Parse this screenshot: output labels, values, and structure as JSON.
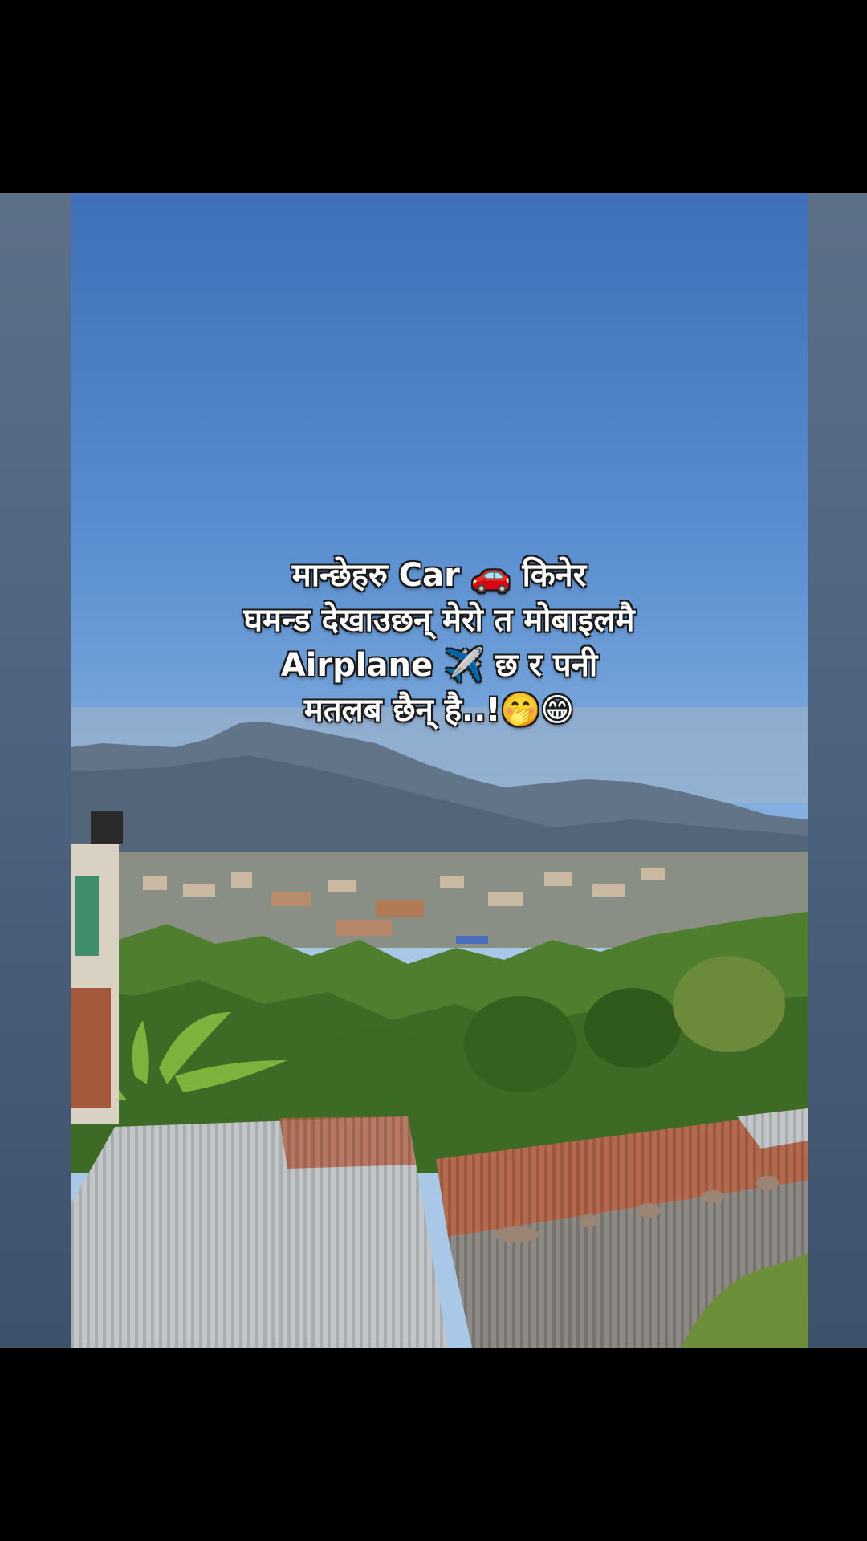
{
  "caption": {
    "line1": "मान्छेहरु Car 🚗 किनेर",
    "line2": "घमन्ड देखाउछन् मेरो त मोबाइलमै",
    "line3": "Airplane ✈️ छ र पनी",
    "line4": "मतलब छैन् है..!🤭😁"
  },
  "colors": {
    "sky_top": "#3f70b8",
    "sky_bottom": "#a9c7e6",
    "mountain": "#5a6b7e",
    "vegetation": "#4a7a2c",
    "roof_rust": "#b0654a",
    "roof_metal": "#c8c8c8"
  }
}
